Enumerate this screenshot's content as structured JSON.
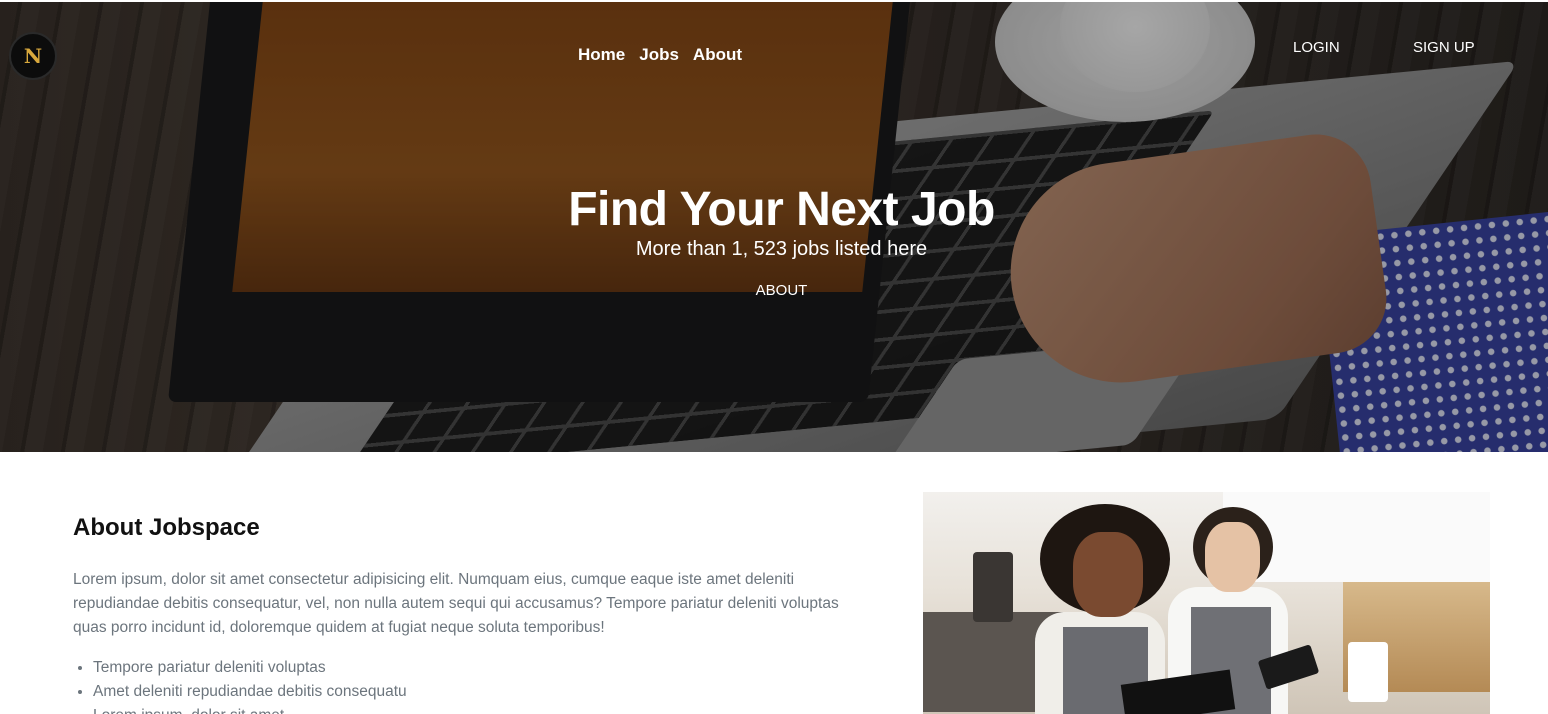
{
  "header": {
    "logo_text": "N",
    "nav": [
      {
        "label": "Home"
      },
      {
        "label": "Jobs"
      },
      {
        "label": "About"
      }
    ],
    "login_label": "LOGIN",
    "signup_label": "SIGN UP"
  },
  "hero": {
    "title": "Find Your Next Job",
    "subtitle": "More than 1, 523 jobs listed here",
    "button_label": "ABOUT"
  },
  "about": {
    "title": "About Jobspace",
    "text": "Lorem ipsum, dolor sit amet consectetur adipisicing elit. Numquam eius, cumque eaque iste amet deleniti repudiandae debitis consequatur, vel, non nulla autem sequi qui accusamus? Tempore pariatur deleniti voluptas quas porro incidunt id, doloremque quidem at fugiat neque soluta temporibus!",
    "list": [
      "Tempore pariatur deleniti voluptas",
      "Amet deleniti repudiandae debitis consequatu",
      "Lorem ipsum, dolor sit amet"
    ]
  },
  "colors": {
    "logo_accent": "#d9a93d",
    "muted_text": "#6c757d",
    "heading_text": "#111111"
  },
  "icons": {
    "logo": "brand-logo-icon"
  }
}
